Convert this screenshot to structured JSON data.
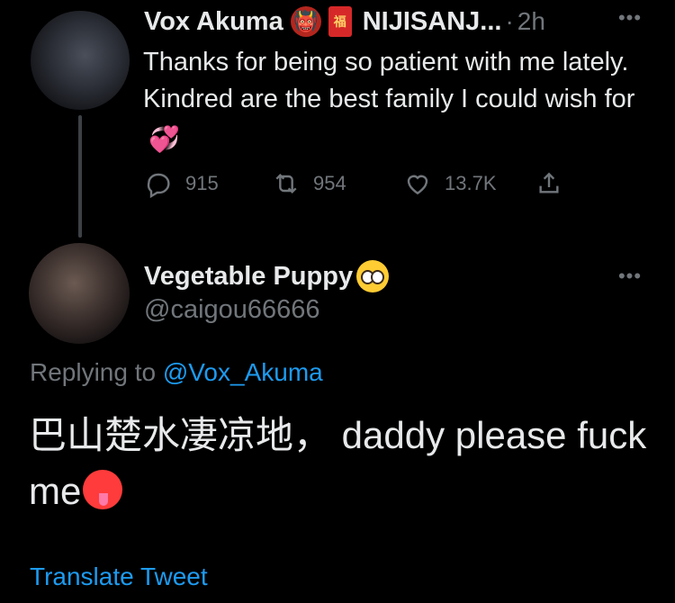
{
  "tweet1": {
    "display_name": "Vox Akuma",
    "emoji1": "👹",
    "emoji2": "福",
    "handle_truncated": "NIJISANJ...",
    "separator": "·",
    "time": "2h",
    "more_icon": "more-dots-icon",
    "text": "Thanks for being so patient with me lately. Kindred are the best family I could wish for",
    "text_emoji": "💞",
    "stats": {
      "replies": "915",
      "retweets": "954",
      "likes": "13.7K"
    },
    "icons": {
      "reply": "reply-bubble-icon",
      "retweet": "retweet-icon",
      "like": "heart-icon",
      "share": "share-icon"
    }
  },
  "tweet2": {
    "display_name": "Vegetable Puppy",
    "name_emoji": "🥺",
    "handle": "@caigou66666",
    "replying_prefix": "Replying to",
    "replying_to": "@Vox_Akuma",
    "text": "巴山楚水凄凉地， daddy please fuck me",
    "text_emoji": "🥵",
    "translate_label": "Translate Tweet"
  },
  "colors": {
    "background": "#000000",
    "text": "#e7e9ea",
    "secondary": "#71767b",
    "link": "#1d9bf0"
  }
}
